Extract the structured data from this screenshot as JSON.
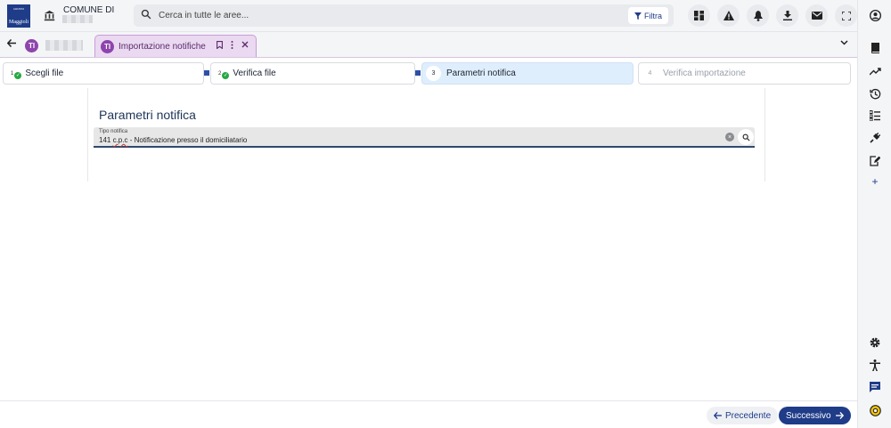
{
  "header": {
    "logo_text": "Maggioli",
    "logo_small_text": "GRUPPO",
    "ente_title": "COMUNE DI",
    "search_placeholder": "Cerca in tutte le aree...",
    "filter_label": "Filtra",
    "icons": [
      "dashboard-icon",
      "alert-icon",
      "bell-icon",
      "download-icon",
      "mail-icon",
      "fullscreen-icon"
    ]
  },
  "tabs": {
    "back_icon": "arrow-left-icon",
    "active_tab_label": "Importazione notifiche",
    "app_icon_text": "TI"
  },
  "steps": [
    {
      "num": "1",
      "label": "Scegli file",
      "state": "done"
    },
    {
      "num": "2",
      "label": "Verifica file",
      "state": "done"
    },
    {
      "num": "3",
      "label": "Parametri notifica",
      "state": "active"
    },
    {
      "num": "4",
      "label": "Verifica importazione",
      "state": "disabled"
    }
  ],
  "form": {
    "section_title": "Parametri notifica",
    "field_label": "Tipo notifica",
    "field_value_prefix": "141 ",
    "field_value_cpc": "c.p.c",
    "field_value_suffix": " - Notificazione presso il domiciliatario"
  },
  "footer": {
    "prev_label": "Precedente",
    "next_label": "Successivo"
  },
  "colors": {
    "primary": "#1f3c88",
    "tab_active_bg": "#ead9f0",
    "success": "#27a844",
    "step_active_bg": "#dfeefc"
  }
}
